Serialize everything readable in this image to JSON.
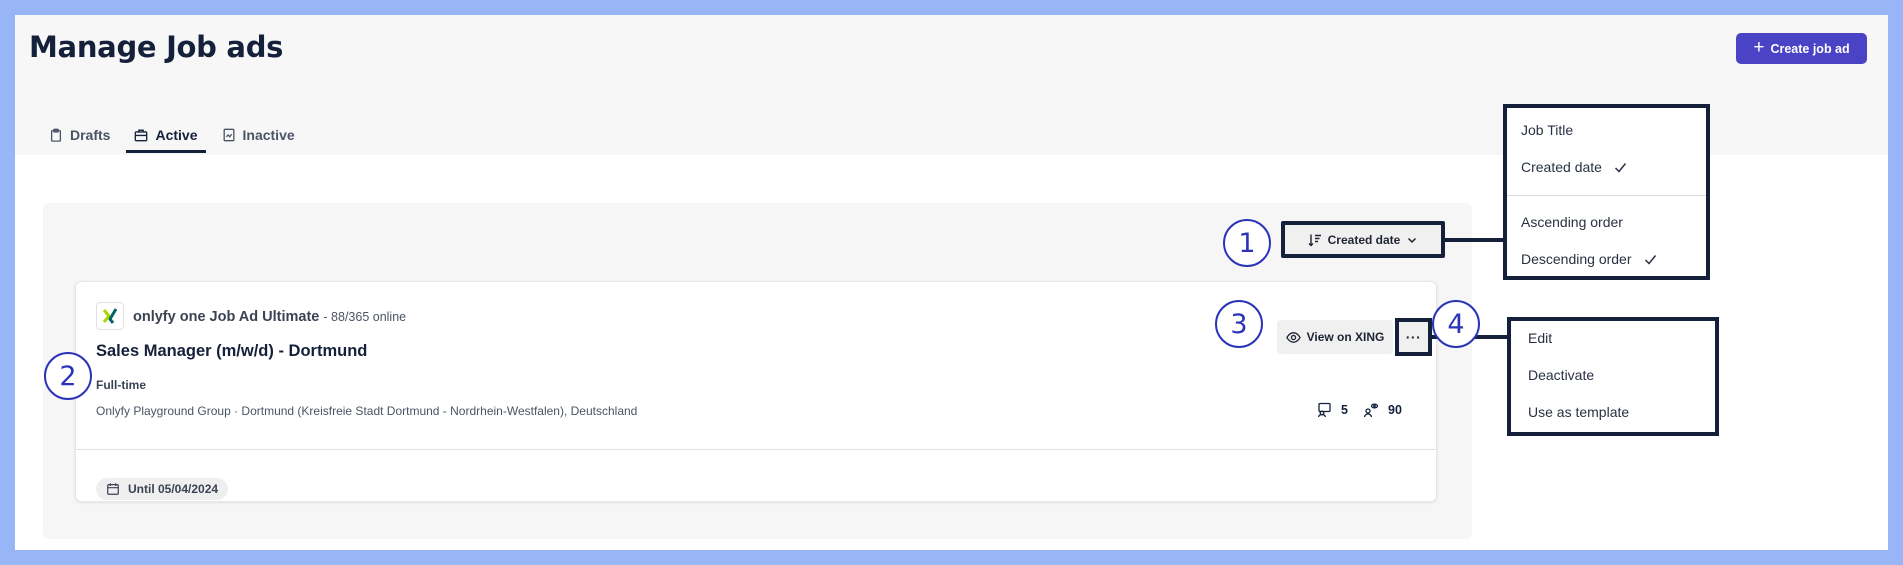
{
  "page": {
    "title": "Manage Job ads",
    "create_button_label": "Create job ad"
  },
  "tabs": [
    {
      "label": "Drafts",
      "icon": "clipboard-icon",
      "active": false
    },
    {
      "label": "Active",
      "icon": "briefcase-icon",
      "active": true
    },
    {
      "label": "Inactive",
      "icon": "chart-file-icon",
      "active": false
    }
  ],
  "sort": {
    "button_label": "Created date",
    "menu": {
      "fields": [
        {
          "label": "Job Title",
          "selected": false
        },
        {
          "label": "Created date",
          "selected": true
        }
      ],
      "orders": [
        {
          "label": "Ascending order",
          "selected": false
        },
        {
          "label": "Descending order",
          "selected": true
        }
      ]
    }
  },
  "job_ad": {
    "product": "onlyfy one Job Ad Ultimate",
    "product_suffix": "- 88/365 online",
    "title": "Sales Manager (m/w/d) - Dortmund",
    "employment_type": "Full-time",
    "location": "Onlyfy Playground Group · Dortmund (Kreisfreie Stadt Dortmund - Nordrhein-Westfalen), Deutschland",
    "applications_count": "5",
    "views_count": "90",
    "view_button_label": "View on XING",
    "more_label": "···",
    "until_label": "Until 05/04/2024"
  },
  "actions_menu": {
    "items": [
      "Edit",
      "Deactivate",
      "Use as template"
    ]
  },
  "callouts": [
    "1",
    "2",
    "3",
    "4"
  ],
  "colors": {
    "accent": "#4a43c6",
    "highlight_border": "#15213b",
    "callout": "#2b34b8",
    "frame": "#98b5f7",
    "xing_green": "#b0d400",
    "xing_teal": "#026466"
  }
}
